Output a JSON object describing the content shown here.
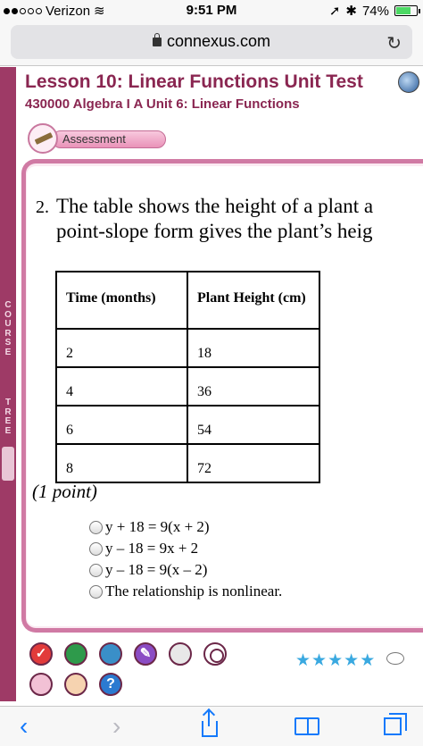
{
  "status": {
    "carrier": "Verizon",
    "time": "9:51 PM",
    "battery": "74%",
    "battery_level": 0.74
  },
  "browser": {
    "url": "connexus.com"
  },
  "course_tree": {
    "top_label": "COURSE",
    "bottom_label": "TREE"
  },
  "header": {
    "lesson_title": "Lesson 10: Linear Functions Unit Test",
    "subtitle": "430000 Algebra I A  Unit 6: Linear Functions",
    "tab_label": "Assessment"
  },
  "question": {
    "number": "2.",
    "line1": "The table shows the height of a plant a",
    "line2": "point-slope form gives the plant’s heig",
    "table": {
      "headers": [
        "Time (months)",
        "Plant Height (cm)"
      ],
      "rows": [
        [
          "2",
          "18"
        ],
        [
          "4",
          "36"
        ],
        [
          "6",
          "54"
        ],
        [
          "8",
          "72"
        ]
      ]
    },
    "points": "(1 point)",
    "options": [
      "y + 18 = 9(x + 2)",
      "y – 18 = 9x + 2",
      "y – 18 = 9(x – 2)",
      "The relationship is nonlinear."
    ]
  },
  "rating": {
    "stars": 5
  }
}
